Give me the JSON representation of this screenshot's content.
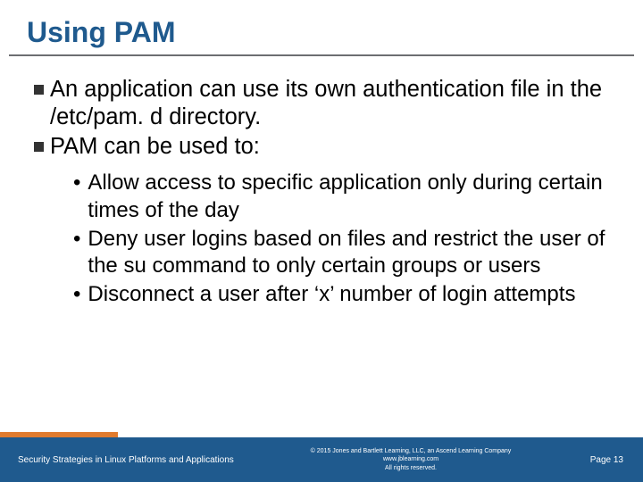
{
  "title": "Using PAM",
  "bullets": [
    "An application can use its own authentication file in the /etc/pam. d directory.",
    "PAM can be used to:"
  ],
  "sub_bullets": [
    "Allow access to specific application only during certain times of the day",
    "Deny user logins based on files and restrict the user of the su command to only certain groups or users",
    "Disconnect a user after ‘x’ number of login attempts"
  ],
  "footer": {
    "left": "Security Strategies in Linux Platforms and Applications",
    "copyright_line1": "© 2015 Jones and Bartlett Learning, LLC, an Ascend Learning Company",
    "copyright_line2": "www.jblearning.com",
    "copyright_line3": "All rights reserved.",
    "page": "Page 13"
  }
}
